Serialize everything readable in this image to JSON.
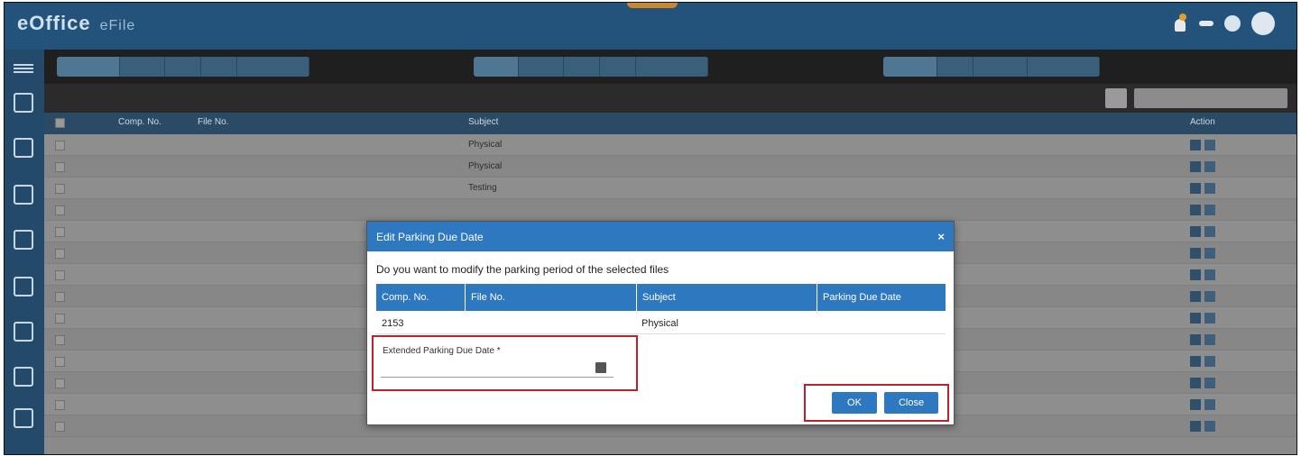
{
  "header": {
    "brand": "eOffice",
    "app_name": "eFile",
    "notification_count": "",
    "badge_label": "",
    "user_name": ""
  },
  "filters": {
    "group1": [
      "",
      "",
      "",
      "",
      ""
    ],
    "group2": [
      "",
      "",
      "",
      "",
      ""
    ],
    "group3": [
      "",
      "",
      "",
      ""
    ]
  },
  "tabbar": {
    "tab_label": "",
    "search_placeholder": ""
  },
  "table": {
    "columns": [
      "",
      "Comp. No.",
      "File No.",
      "Subject",
      "",
      "",
      "",
      "Action"
    ],
    "rows": [
      {
        "comp": "",
        "file": "",
        "subject": "Physical",
        "date1": "",
        "date2": "",
        "user": ""
      },
      {
        "comp": "",
        "file": "",
        "subject": "Physical",
        "date1": "",
        "date2": "",
        "user": ""
      },
      {
        "comp": "",
        "file": "",
        "subject": "Testing",
        "date1": "",
        "date2": "",
        "user": ""
      },
      {
        "comp": "",
        "file": "",
        "subject": "",
        "date1": "",
        "date2": "",
        "user": ""
      },
      {
        "comp": "",
        "file": "",
        "subject": "",
        "date1": "",
        "date2": "",
        "user": ""
      },
      {
        "comp": "",
        "file": "",
        "subject": "",
        "date1": "",
        "date2": "",
        "user": ""
      },
      {
        "comp": "",
        "file": "",
        "subject": "",
        "date1": "",
        "date2": "",
        "user": ""
      },
      {
        "comp": "",
        "file": "",
        "subject": "",
        "date1": "",
        "date2": "",
        "user": ""
      },
      {
        "comp": "",
        "file": "",
        "subject": "",
        "date1": "",
        "date2": "",
        "user": ""
      },
      {
        "comp": "",
        "file": "",
        "subject": "",
        "date1": "",
        "date2": "",
        "user": ""
      },
      {
        "comp": "",
        "file": "",
        "subject": "",
        "date1": "",
        "date2": "",
        "user": ""
      },
      {
        "comp": "",
        "file": "",
        "subject": "",
        "date1": "",
        "date2": "",
        "user": ""
      },
      {
        "comp": "",
        "file": "",
        "subject": "",
        "date1": "",
        "date2": "",
        "user": ""
      },
      {
        "comp": "",
        "file": "",
        "subject": "",
        "date1": "",
        "date2": "",
        "user": ""
      }
    ]
  },
  "modal": {
    "title": "Edit Parking Due Date",
    "close_glyph": "×",
    "question": "Do you want to modify the parking period of the selected files",
    "columns": [
      "Comp. No.",
      "File No.",
      "Subject",
      "Parking Due Date"
    ],
    "row": {
      "comp": "2153",
      "file": "",
      "subject": "Physical",
      "due": ""
    },
    "extended_label": "Extended Parking Due Date *",
    "extended_value": "",
    "ok_label": "OK",
    "close_label": "Close"
  }
}
